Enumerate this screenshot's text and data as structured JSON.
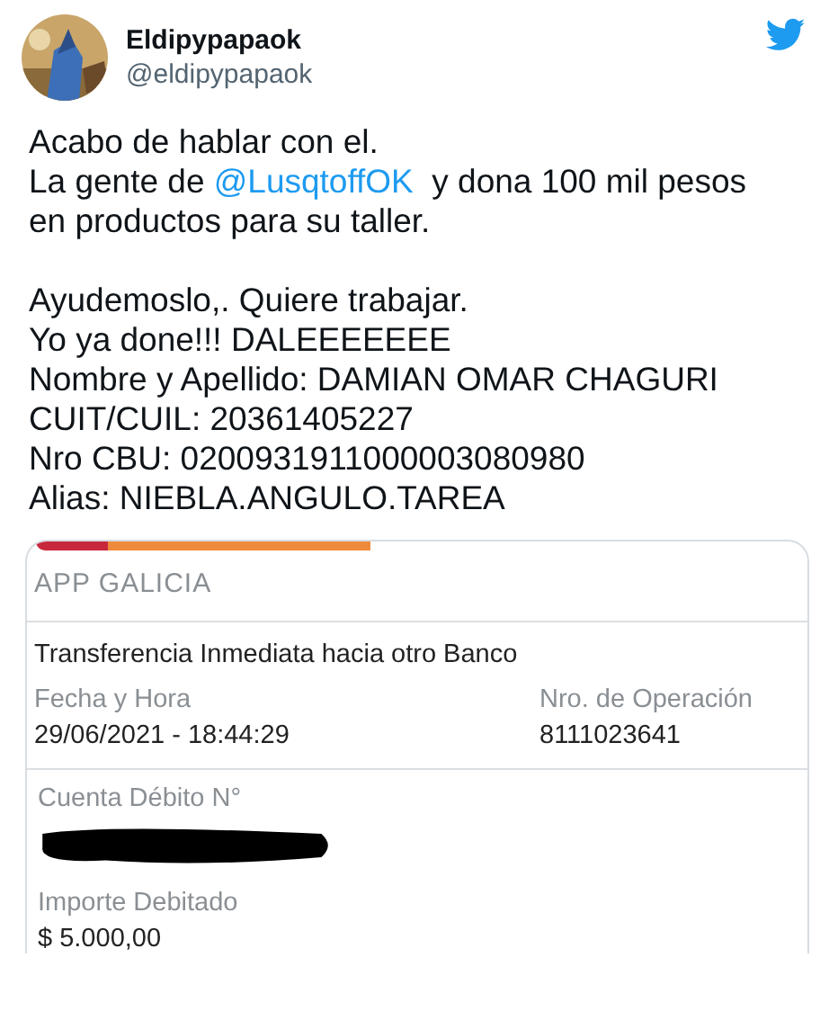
{
  "tweet": {
    "author": {
      "name": "Eldipypapaok",
      "handle": "@eldipypapaok"
    },
    "paragraphs": [
      {
        "lines": [
          "Acabo de hablar con el."
        ],
        "before": "La gente de ",
        "mention": "@LusqtoffOK",
        "after": "  y dona 100 mil pesos\nen productos para su taller."
      },
      {
        "lines": [
          "Ayudemoslo,. Quiere trabajar.",
          "Yo ya done!!! DALEEEEEEE",
          "Nombre y Apellido: DAMIAN OMAR CHAGURI",
          "CUIT/CUIL: 20361405227",
          "Nro CBU: 0200931911000003080980",
          "Alias: NIEBLA.ANGULO.TAREA"
        ]
      }
    ]
  },
  "receipt": {
    "app": "APP GALICIA",
    "operation": "Transferencia Inmediata hacia otro Banco",
    "fields": [
      {
        "label": "Fecha y Hora",
        "value": "29/06/2021 -  18:44:29"
      },
      {
        "label": "Nro. de Operación",
        "value": "8111023641"
      }
    ],
    "account": {
      "label": "Cuenta Débito N°",
      "redacted": true
    },
    "amount": {
      "label": "Importe Debitado",
      "value": "$ 5.000,00"
    }
  }
}
